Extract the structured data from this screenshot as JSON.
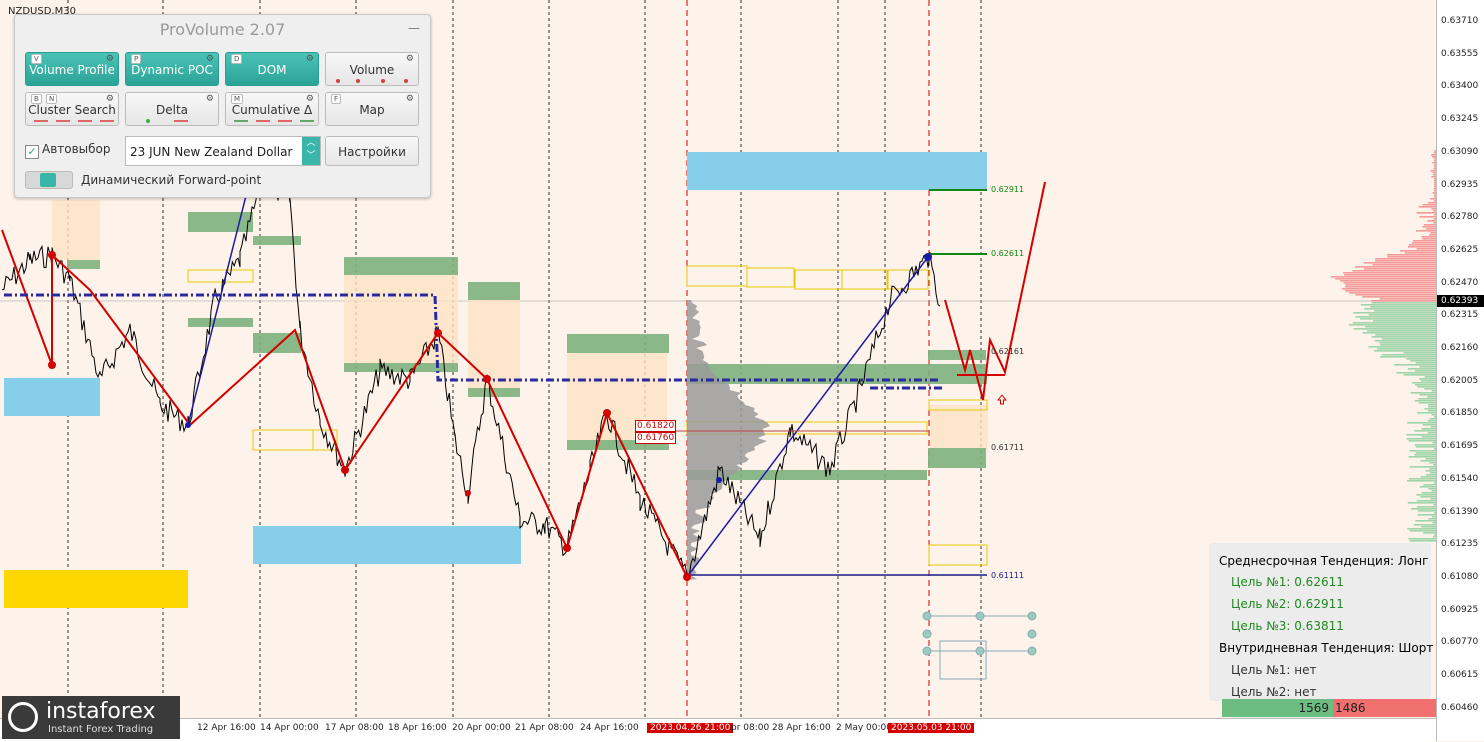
{
  "symbol": "NZDUSD,M30",
  "panel": {
    "title": "ProVolume 2.07",
    "buttons": [
      {
        "label": "Volume Profile",
        "key": "V",
        "active": true
      },
      {
        "label": "Dynamic POC",
        "key": "P",
        "active": true
      },
      {
        "label": "DOM",
        "key": "D",
        "active": true
      },
      {
        "label": "Volume",
        "key": "",
        "active": false
      },
      {
        "label": "Cluster Search",
        "key": "B",
        "key2": "N",
        "active": false
      },
      {
        "label": "Delta",
        "key": "",
        "active": false
      },
      {
        "label": "Cumulative Δ",
        "key": "M",
        "active": false
      },
      {
        "label": "Map",
        "key": "F",
        "active": false
      }
    ],
    "autoselect_label": "Автовыбор",
    "instrument": "23 JUN New Zealand Dollar",
    "settings_label": "Настройки",
    "forward_label": "Динамический Forward-point"
  },
  "price_axis": [
    "0.63710",
    "0.63555",
    "0.63400",
    "0.63245",
    "0.63090",
    "0.62935",
    "0.62780",
    "0.62625",
    "0.62470",
    "0.62315",
    "0.62160",
    "0.62005",
    "0.61850",
    "0.61695",
    "0.61540",
    "0.61390",
    "0.61235",
    "0.61080",
    "0.60925",
    "0.60770",
    "0.60615",
    "0.60460"
  ],
  "current_price": "0.62393",
  "time_axis": [
    {
      "label": "12 Apr 16:00",
      "hl": false
    },
    {
      "label": "14 Apr 00:00",
      "hl": false
    },
    {
      "label": "17 Apr 08:00",
      "hl": false
    },
    {
      "label": "18 Apr 16:00",
      "hl": false
    },
    {
      "label": "20 Apr 00:00",
      "hl": false
    },
    {
      "label": "21 Apr 08:00",
      "hl": false
    },
    {
      "label": "24 Apr 16:00",
      "hl": false
    },
    {
      "label": "2023.04.26 21:00",
      "hl": true
    },
    {
      "label": "pr 08:00",
      "hl": false
    },
    {
      "label": "28 Apr 16:00",
      "hl": false
    },
    {
      "label": "2 May 00:00",
      "hl": false
    },
    {
      "label": "2023.05.03 21:00",
      "hl": true
    }
  ],
  "levels": {
    "l1": "0.62911",
    "l2": "0.62611",
    "l3": "0.62161",
    "l4": "0.61711",
    "l5": "0.61111",
    "tag1": "0.61820",
    "tag2": "0.61760"
  },
  "trend": {
    "mid_title": "Среднесрочная Тенденция: Лонг",
    "targets": [
      "Цель №1: 0.62611",
      "Цель №2: 0.62911",
      "Цель №3: 0.63811"
    ],
    "intra_title": "Внутридневная Тенденция: Шорт",
    "intra_targets": [
      "Цель №1: нет",
      "Цель №2: нет"
    ]
  },
  "volume": {
    "buy": "1569",
    "sell": "1486"
  },
  "logo": {
    "name": "instaforex",
    "sub": "Instant Forex Trading"
  },
  "colors": {
    "accent": "#3ab5a9",
    "zone_blue": "#87ceeb",
    "zone_green": "#7fb27f",
    "zone_yellow": "#ffd700",
    "zigzag": "#d40000",
    "trendline": "#1a1aa6"
  }
}
